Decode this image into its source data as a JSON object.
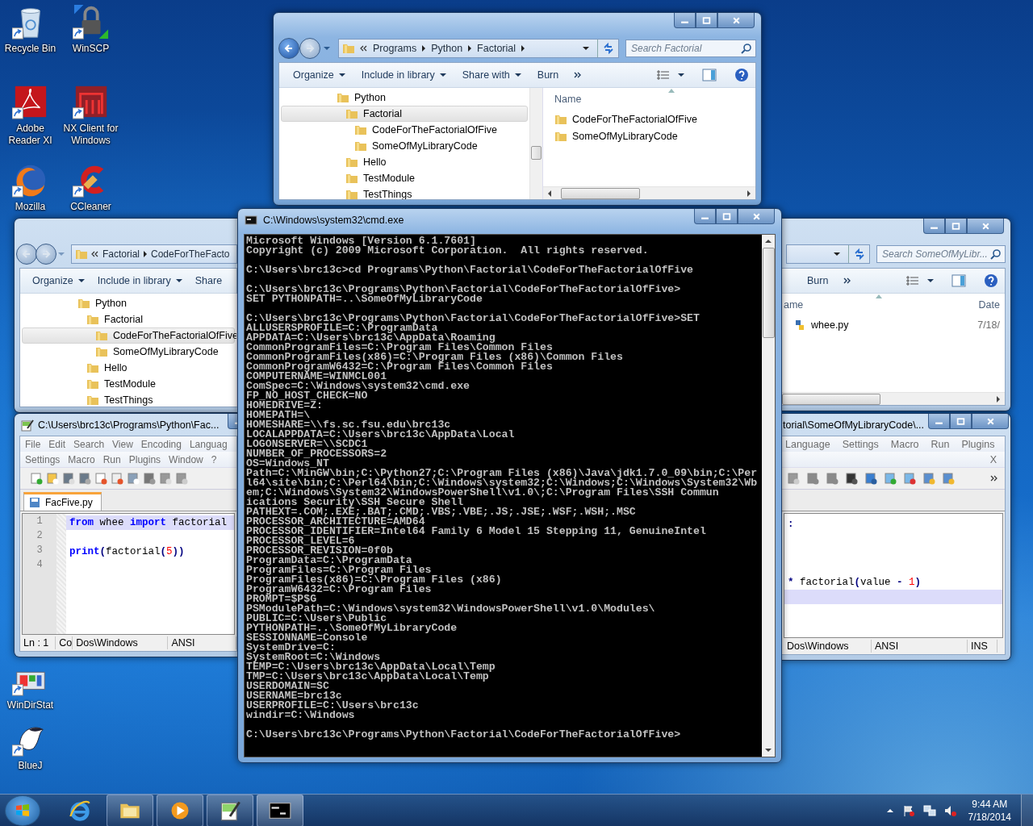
{
  "desktop_icons": [
    {
      "label": "Recycle Bin"
    },
    {
      "label": "WinSCP"
    },
    {
      "label": "Adobe Reader XI"
    },
    {
      "label": "NX Client for Windows"
    },
    {
      "label": "Mozilla"
    },
    {
      "label": "CCleaner"
    },
    {
      "label": "WinDirStat"
    },
    {
      "label": "BlueJ"
    }
  ],
  "explorer_top": {
    "breadcrumb": [
      "Programs",
      "Python",
      "Factorial"
    ],
    "search_placeholder": "Search Factorial",
    "toolbar": [
      {
        "label": "Organize",
        "has_menu": true
      },
      {
        "label": "Include in library",
        "has_menu": true
      },
      {
        "label": "Share with",
        "has_menu": true
      },
      {
        "label": "Burn",
        "has_menu": false
      }
    ],
    "tree": [
      {
        "label": "Python",
        "selected": false,
        "children": [
          {
            "label": "Factorial",
            "selected": true,
            "children": [
              {
                "label": "CodeForTheFactorialOfFive",
                "selected": false
              },
              {
                "label": "SomeOfMyLibraryCode",
                "selected": false
              }
            ]
          },
          {
            "label": "Hello",
            "selected": false
          },
          {
            "label": "TestModule",
            "selected": false
          },
          {
            "label": "TestThings",
            "selected": false
          }
        ]
      }
    ],
    "name_column": "Name",
    "files": [
      {
        "name": "CodeForTheFactorialOfFive",
        "kind": "folder"
      },
      {
        "name": "SomeOfMyLibraryCode",
        "kind": "folder"
      }
    ]
  },
  "explorer_left": {
    "breadcrumb": [
      "Factorial",
      "CodeForTheFacto"
    ],
    "toolbar": [
      {
        "label": "Organize",
        "has_menu": true
      },
      {
        "label": "Include in library",
        "has_menu": true
      },
      {
        "label": "Share",
        "has_menu": false
      }
    ],
    "tree": [
      {
        "label": "Python",
        "selected": false,
        "children": [
          {
            "label": "Factorial",
            "selected": false,
            "children": [
              {
                "label": "CodeForTheFactorialOfFive",
                "selected": true
              },
              {
                "label": "SomeOfMyLibraryCode",
                "selected": false
              }
            ]
          },
          {
            "label": "Hello",
            "selected": false
          },
          {
            "label": "TestModule",
            "selected": false
          },
          {
            "label": "TestThings",
            "selected": false
          }
        ]
      }
    ]
  },
  "explorer_right": {
    "search_placeholder": "Search SomeOfMyLibr...",
    "toolbar": [
      {
        "label": "Burn",
        "has_menu": false
      }
    ],
    "columns": [
      "ame",
      "Date"
    ],
    "files": [
      {
        "name": "whee.py",
        "kind": "python",
        "date": "7/18/"
      }
    ]
  },
  "notepad_left": {
    "title": "C:\\Users\\brc13c\\Programs\\Python\\Fac...",
    "menu": [
      [
        "File",
        "Edit",
        "Search",
        "View",
        "Encoding",
        "Languag"
      ],
      [
        "Settings",
        "Macro",
        "Run",
        "Plugins",
        "Window",
        "?"
      ]
    ],
    "tabs": [
      {
        "label": "FacFive.py",
        "selected": true
      }
    ],
    "lines": [
      {
        "number": "1",
        "current": true,
        "tokens": [
          {
            "text": "from",
            "kind": "keyword"
          },
          {
            "text": " whee ",
            "kind": "plain"
          },
          {
            "text": "import",
            "kind": "keyword"
          },
          {
            "text": " factorial",
            "kind": "plain"
          }
        ]
      },
      {
        "number": "2",
        "current": false
      },
      {
        "number": "3",
        "current": false,
        "tokens": [
          {
            "text": "print",
            "kind": "keyword"
          },
          {
            "text": "(",
            "kind": "operator"
          },
          {
            "text": "factorial",
            "kind": "plain"
          },
          {
            "text": "(",
            "kind": "operator"
          },
          {
            "text": "5",
            "kind": "number"
          },
          {
            "text": "))",
            "kind": "operator"
          }
        ]
      },
      {
        "number": "4",
        "current": false
      }
    ],
    "status": [
      "Ln : 1",
      "Co",
      "Dos\\Windows",
      "ANSI"
    ]
  },
  "notepad_right": {
    "title": "torial\\SomeOfMyLibraryCode\\...",
    "menu": [
      "Language",
      "Settings",
      "Macro",
      "Run",
      "Plugins"
    ],
    "close_doc": "X",
    "lines": [
      {
        "current": false,
        "tokens": [
          {
            "text": ":",
            "kind": "operator"
          }
        ]
      },
      {
        "current": false
      },
      {
        "current": false
      },
      {
        "current": false
      },
      {
        "current": false,
        "tokens": [
          {
            "text": "* ",
            "kind": "operator"
          },
          {
            "text": "factorial",
            "kind": "plain"
          },
          {
            "text": "(",
            "kind": "operator"
          },
          {
            "text": "value ",
            "kind": "plain"
          },
          {
            "text": "- ",
            "kind": "operator"
          },
          {
            "text": "1",
            "kind": "number"
          },
          {
            "text": ")",
            "kind": "operator"
          }
        ]
      },
      {
        "current": true
      }
    ],
    "status": [
      "Dos\\Windows",
      "ANSI",
      "INS"
    ]
  },
  "cmd": {
    "title": "C:\\Windows\\system32\\cmd.exe",
    "blocks": [
      [
        "Microsoft Windows [Version 6.1.7601]",
        "Copyright (c) 2009 Microsoft Corporation.  All rights reserved."
      ],
      [
        "C:\\Users\\brc13c>cd Programs\\Python\\Factorial\\CodeForTheFactorialOfFive"
      ],
      [
        "C:\\Users\\brc13c\\Programs\\Python\\Factorial\\CodeForTheFactorialOfFive>",
        "SET PYTHONPATH=..\\SomeOfMyLibraryCode"
      ],
      [
        "C:\\Users\\brc13c\\Programs\\Python\\Factorial\\CodeForTheFactorialOfFive>SET",
        "ALLUSERSPROFILE=C:\\ProgramData",
        "APPDATA=C:\\Users\\brc13c\\AppData\\Roaming",
        "CommonProgramFiles=C:\\Program Files\\Common Files",
        "CommonProgramFiles(x86)=C:\\Program Files (x86)\\Common Files",
        "CommonProgramW6432=C:\\Program Files\\Common Files",
        "COMPUTERNAME=WINMCL001",
        "ComSpec=C:\\Windows\\system32\\cmd.exe",
        "FP_NO_HOST_CHECK=NO",
        "HOMEDRIVE=Z:",
        "HOMEPATH=\\",
        "HOMESHARE=\\\\fs.sc.fsu.edu\\brc13c",
        "LOCALAPPDATA=C:\\Users\\brc13c\\AppData\\Local",
        "LOGONSERVER=\\\\SCDC1",
        "NUMBER_OF_PROCESSORS=2",
        "OS=Windows_NT",
        "Path=C:\\MinGW\\bin;C:\\Python27;C:\\Program Files (x86)\\Java\\jdk1.7.0_09\\bin;C:\\Per",
        "l64\\site\\bin;C:\\Perl64\\bin;C:\\Windows\\system32;C:\\Windows;C:\\Windows\\System32\\Wb",
        "em;C:\\Windows\\System32\\WindowsPowerShell\\v1.0\\;C:\\Program Files\\SSH Commun",
        "ications Security\\SSH Secure Shell",
        "PATHEXT=.COM;.EXE;.BAT;.CMD;.VBS;.VBE;.JS;.JSE;.WSF;.WSH;.MSC",
        "PROCESSOR_ARCHITECTURE=AMD64",
        "PROCESSOR_IDENTIFIER=Intel64 Family 6 Model 15 Stepping 11, GenuineIntel",
        "PROCESSOR_LEVEL=6",
        "PROCESSOR_REVISION=0f0b",
        "ProgramData=C:\\ProgramData",
        "ProgramFiles=C:\\Program Files",
        "ProgramFiles(x86)=C:\\Program Files (x86)",
        "ProgramW6432=C:\\Program Files",
        "PROMPT=$P$G",
        "PSModulePath=C:\\Windows\\system32\\WindowsPowerShell\\v1.0\\Modules\\",
        "PUBLIC=C:\\Users\\Public",
        "PYTHONPATH=..\\SomeOfMyLibraryCode",
        "SESSIONNAME=Console",
        "SystemDrive=C:",
        "SystemRoot=C:\\Windows",
        "TEMP=C:\\Users\\brc13c\\AppData\\Local\\Temp",
        "TMP=C:\\Users\\brc13c\\AppData\\Local\\Temp",
        "USERDOMAIN=SC",
        "USERNAME=brc13c",
        "USERPROFILE=C:\\Users\\brc13c",
        "windir=C:\\Windows"
      ],
      [
        "C:\\Users\\brc13c\\Programs\\Python\\Factorial\\CodeForTheFactorialOfFive>"
      ]
    ]
  },
  "taskbar": {
    "time": "9:44 AM",
    "date": "7/18/2014"
  }
}
